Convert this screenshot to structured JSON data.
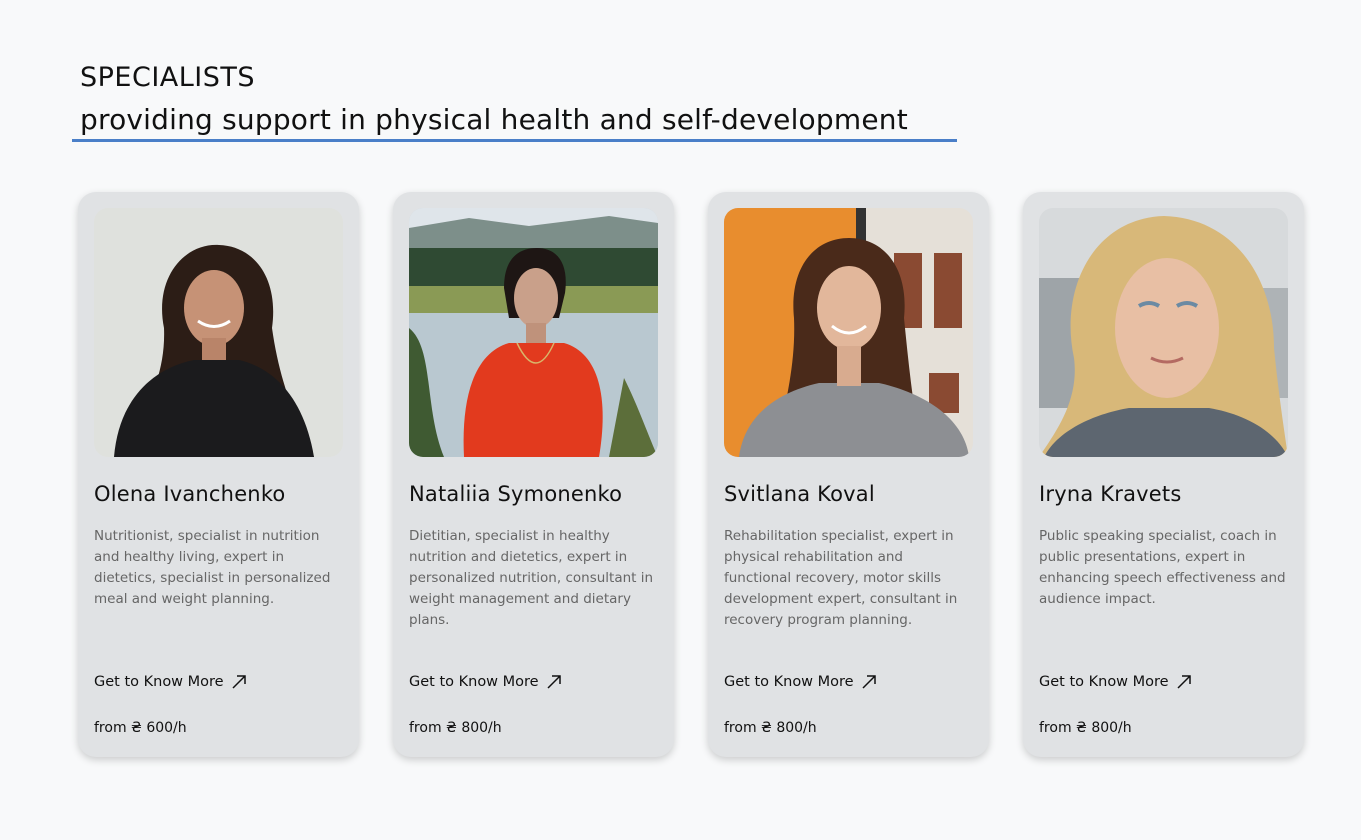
{
  "section": {
    "title": "SPECIALISTS",
    "subtitle": "providing support in physical health and self-development"
  },
  "colors": {
    "accent_underline": "#4a7fc8",
    "card_background": "#e0e2e4",
    "page_background": "#f8f9fa"
  },
  "specialists": [
    {
      "name": "Olena Ivanchenko",
      "description": "Nutritionist, specialist in nutrition and healthy living, expert in dietetics, specialist in personalized meal and weight planning.",
      "link_label": "Get to Know More",
      "price": "from ₴ 600/h",
      "photo_icon": "portrait-photo"
    },
    {
      "name": "Nataliia Symonenko",
      "description": "Dietitian, specialist in healthy nutrition and dietetics, expert in personalized nutrition, consultant in weight management and dietary plans.",
      "link_label": "Get to Know More",
      "price": "from ₴ 800/h",
      "photo_icon": "portrait-photo"
    },
    {
      "name": "Svitlana Koval",
      "description": "Rehabilitation specialist, expert in physical rehabilitation and functional recovery, motor skills development expert, consultant in recovery program planning.",
      "link_label": "Get to Know More",
      "price": "from ₴ 800/h",
      "photo_icon": "portrait-photo"
    },
    {
      "name": "Iryna Kravets",
      "description": "Public speaking specialist, coach in public presentations, expert in enhancing speech effectiveness and audience impact.",
      "link_label": "Get to Know More",
      "price": "from ₴ 800/h",
      "photo_icon": "portrait-photo"
    }
  ]
}
